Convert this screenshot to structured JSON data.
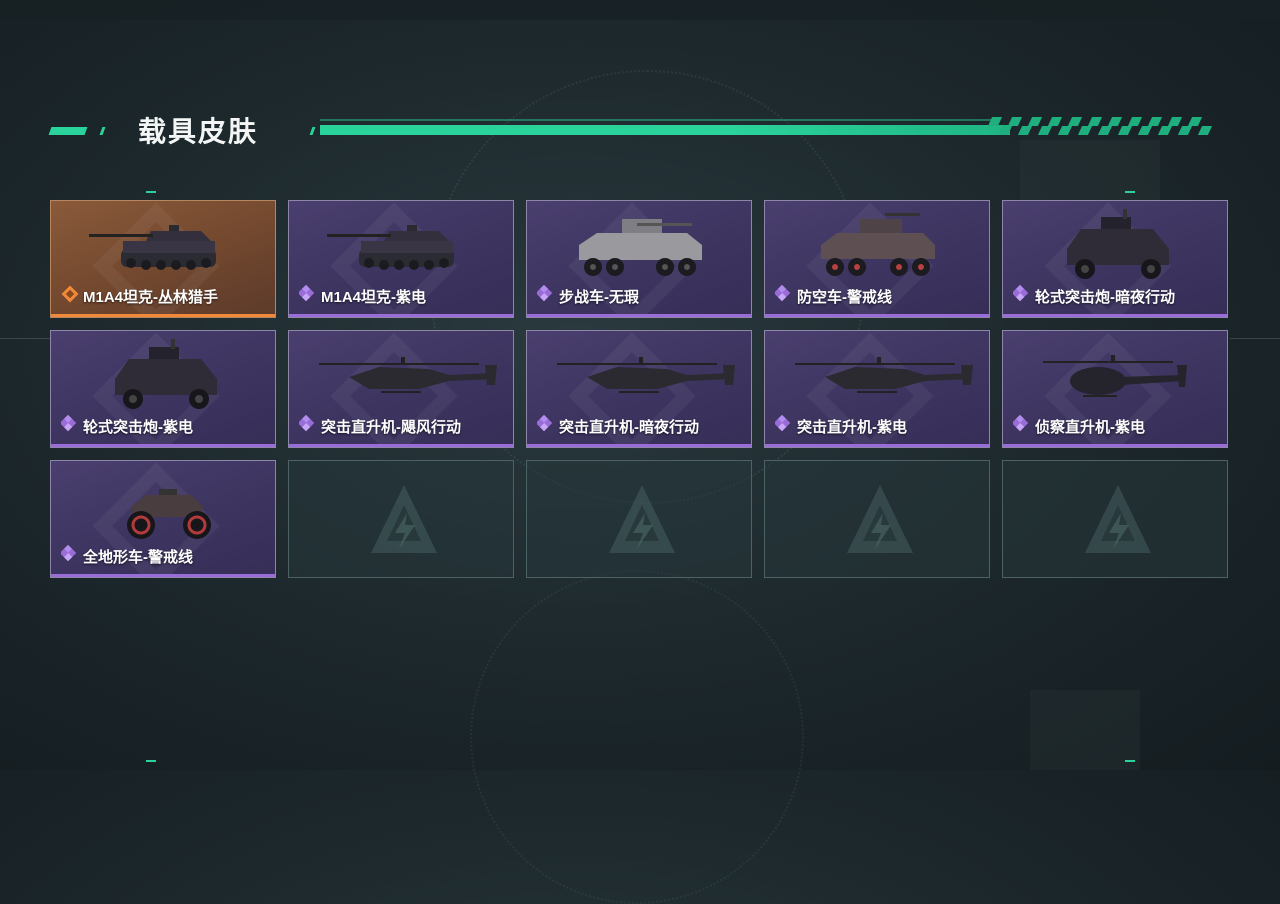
{
  "header": {
    "title": "载具皮肤"
  },
  "colors": {
    "accent": "#2ad39a",
    "epic": "#9a6cd8",
    "legendary": "#f08a3a"
  },
  "skins": [
    {
      "label": "M1A4坦克-丛林猎手",
      "rarity": "legendary",
      "vehicle": "tank"
    },
    {
      "label": "M1A4坦克-紫电",
      "rarity": "epic",
      "vehicle": "tank"
    },
    {
      "label": "步战车-无瑕",
      "rarity": "epic",
      "vehicle": "ifv"
    },
    {
      "label": "防空车-警戒线",
      "rarity": "epic",
      "vehicle": "aa-vehicle"
    },
    {
      "label": "轮式突击炮-暗夜行动",
      "rarity": "epic",
      "vehicle": "armored-car"
    },
    {
      "label": "轮式突击炮-紫电",
      "rarity": "epic",
      "vehicle": "armored-car"
    },
    {
      "label": "突击直升机-飓风行动",
      "rarity": "epic",
      "vehicle": "attack-helicopter"
    },
    {
      "label": "突击直升机-暗夜行动",
      "rarity": "epic",
      "vehicle": "attack-helicopter"
    },
    {
      "label": "突击直升机-紫电",
      "rarity": "epic",
      "vehicle": "attack-helicopter"
    },
    {
      "label": "侦察直升机-紫电",
      "rarity": "epic",
      "vehicle": "scout-helicopter"
    },
    {
      "label": "全地形车-警戒线",
      "rarity": "epic",
      "vehicle": "atv"
    }
  ],
  "empty_slots": 4
}
